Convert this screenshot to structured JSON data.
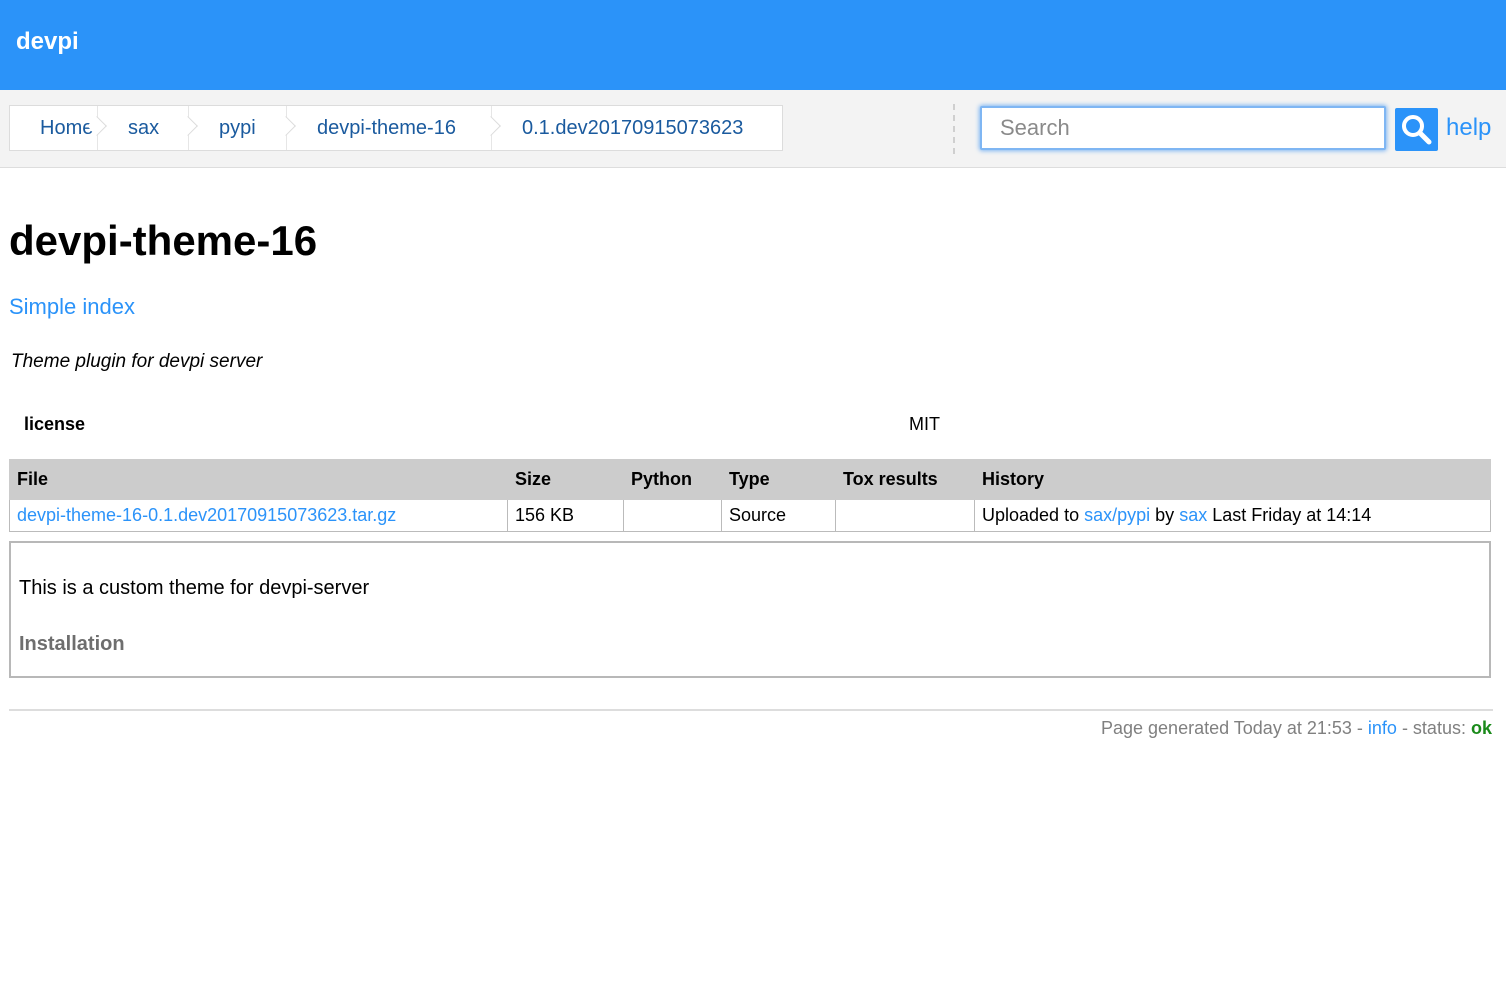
{
  "header": {
    "logo": "devpi"
  },
  "breadcrumbs": [
    "Home",
    "sax",
    "pypi",
    "devpi-theme-16",
    "0.1.dev20170915073623"
  ],
  "search": {
    "placeholder": "Search",
    "button_icon": "search-icon"
  },
  "help_link": "help",
  "project": {
    "title": "devpi-theme-16",
    "simple_index_link": "Simple index",
    "summary": "Theme plugin for devpi server",
    "metadata": [
      {
        "key": "license",
        "value": "MIT"
      }
    ]
  },
  "files_table": {
    "headers": [
      "File",
      "Size",
      "Python",
      "Type",
      "Tox results",
      "History"
    ],
    "rows": [
      {
        "file": "devpi-theme-16-0.1.dev20170915073623.tar.gz",
        "size": "156 KB",
        "python": "",
        "type": "Source",
        "tox": "",
        "history": {
          "prefix": "Uploaded to",
          "index_link": "sax/pypi",
          "by": "by",
          "user_link": "sax",
          "when": "Last Friday at 14:14"
        }
      }
    ]
  },
  "description": {
    "text": "This is a custom theme for devpi-server",
    "heading": "Installation"
  },
  "footer": {
    "generated": "Page generated Today at 21:53 -",
    "info_link": "info",
    "status_label": "- status:",
    "status_value": "ok"
  },
  "colors": {
    "brand": "#2b93f9",
    "status_ok": "#1a8a1a"
  }
}
